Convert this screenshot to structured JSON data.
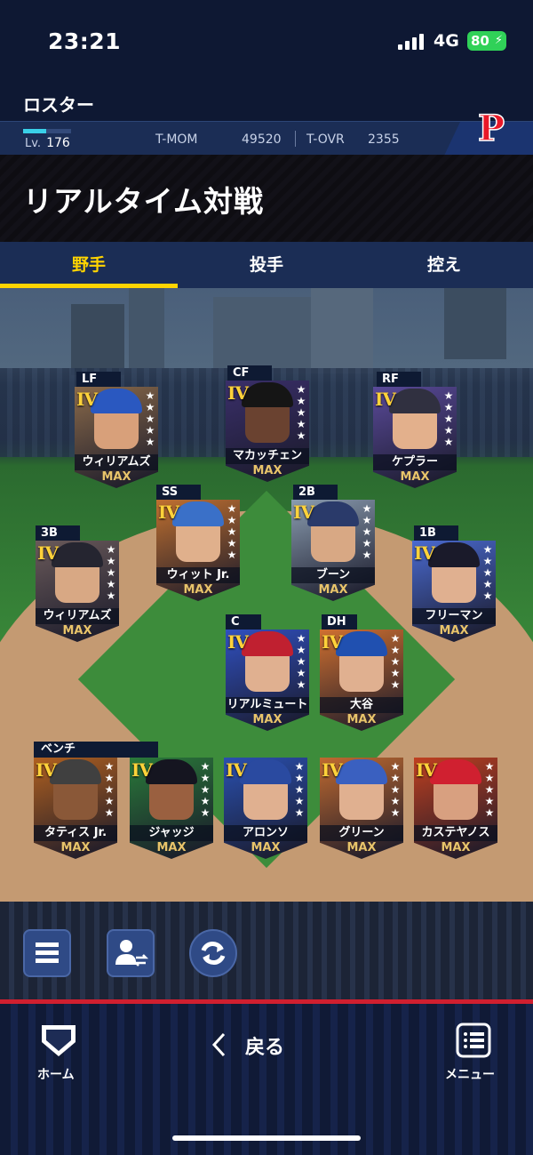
{
  "status": {
    "time": "23:21",
    "network": "4G",
    "battery": "80"
  },
  "header": {
    "screen": "ロスター",
    "level_label": "Lv.",
    "level": "176",
    "tmom_label": "T-MOM",
    "tmom": "49520",
    "tovr_label": "T-OVR",
    "tovr": "2355",
    "team_logo": "P"
  },
  "title": "リアルタイム対戦",
  "tabs": [
    {
      "label": "野手",
      "active": true
    },
    {
      "label": "投手",
      "active": false
    },
    {
      "label": "控え",
      "active": false
    }
  ],
  "tier": "IV",
  "grade": "MAX",
  "players": [
    {
      "pos": "LF",
      "name": "ウィリアムズ"
    },
    {
      "pos": "CF",
      "name": "マカッチェン"
    },
    {
      "pos": "RF",
      "name": "ケプラー"
    },
    {
      "pos": "SS",
      "name": "ウィット Jr."
    },
    {
      "pos": "2B",
      "name": "ブーン"
    },
    {
      "pos": "3B",
      "name": "ウィリアムズ"
    },
    {
      "pos": "1B",
      "name": "フリーマン"
    },
    {
      "pos": "C",
      "name": "リアルミュート"
    },
    {
      "pos": "DH",
      "name": "大谷"
    }
  ],
  "bench": {
    "label": "ベンチ",
    "players": [
      {
        "name": "タティス Jr."
      },
      {
        "name": "ジャッジ"
      },
      {
        "name": "アロンソ"
      },
      {
        "name": "グリーン"
      },
      {
        "name": "カステヤノス"
      }
    ]
  },
  "nav": {
    "home": "ホーム",
    "back": "戻る",
    "menu": "メニュー"
  },
  "icons": [
    "menu-list-icon",
    "swap-player-icon",
    "refresh-icon",
    "home-plate-icon",
    "back-chevron-icon",
    "menu-icon"
  ]
}
